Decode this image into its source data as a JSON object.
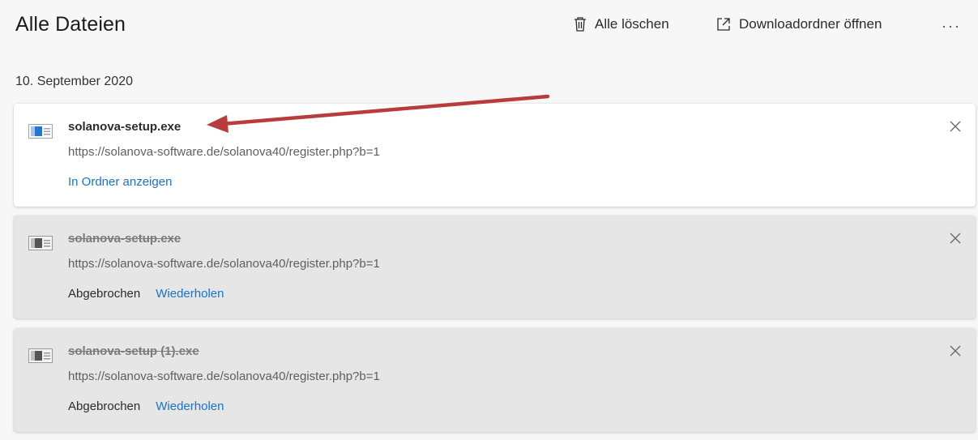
{
  "header": {
    "title": "Alle Dateien",
    "delete_all_label": "Alle löschen",
    "open_folder_label": "Downloadordner öffnen",
    "more_label": "···"
  },
  "group": {
    "date": "10. September 2020"
  },
  "downloads": [
    {
      "filename": "solanova-setup.exe",
      "url": "https://solanova-software.de/solanova40/register.php?b=1",
      "action_label": "In Ordner anzeigen",
      "state": "completed"
    },
    {
      "filename": "solanova-setup.exe",
      "url": "https://solanova-software.de/solanova40/register.php?b=1",
      "status_label": "Abgebrochen",
      "retry_label": "Wiederholen",
      "state": "cancelled"
    },
    {
      "filename": "solanova-setup (1).exe",
      "url": "https://solanova-software.de/solanova40/register.php?b=1",
      "status_label": "Abgebrochen",
      "retry_label": "Wiederholen",
      "state": "cancelled"
    }
  ],
  "colors": {
    "link": "#1a73c6",
    "annotation_arrow": "#b83c3c",
    "active_file_icon": "#1e78d6",
    "inactive_file_icon": "#555555"
  },
  "icons": [
    "trash-icon",
    "external-link-icon",
    "more-icon",
    "file-icon",
    "close-icon",
    "annotation-arrow"
  ]
}
